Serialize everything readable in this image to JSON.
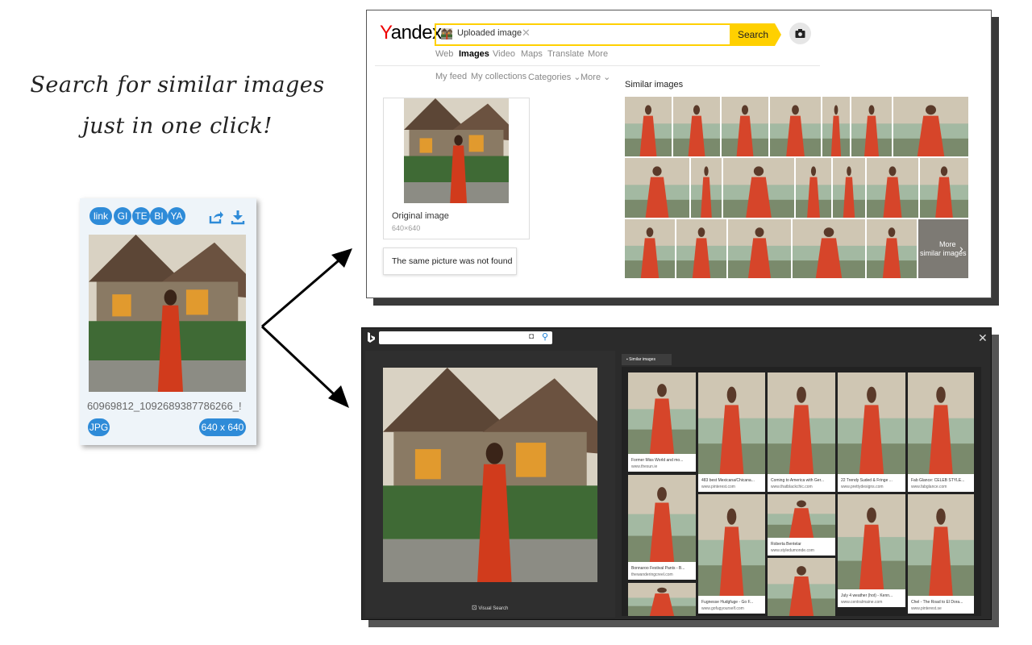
{
  "headline": {
    "line1": "Search for similar images",
    "line2": "just in one click!"
  },
  "extension": {
    "buttons": [
      "link",
      "GI",
      "TE",
      "BI",
      "YA"
    ],
    "filename": "60969812_1092689387786266_!",
    "format": "JPG",
    "dimensions": "640 x 640"
  },
  "yandex": {
    "logo_first": "Y",
    "logo_rest": "andex",
    "search_chip": "Uploaded image",
    "search_button": "Search",
    "nav": [
      "Web",
      "Images",
      "Video",
      "Maps",
      "Translate",
      "More"
    ],
    "subnav": [
      "My feed",
      "My collections",
      "Categories",
      "More"
    ],
    "similar_title": "Similar images",
    "original_label": "Original image",
    "original_size": "640×640",
    "not_found": "The same picture was not found",
    "more_similar_line1": "More",
    "more_similar_line2": "similar images"
  },
  "bing": {
    "tab_label": "Similar images",
    "visual_search": "Visual Search",
    "cards": [
      {
        "caption": "Former Miss World and mo...",
        "url": "www.thesun.ie"
      },
      {
        "caption": "483 best Mexicana/Chicana...",
        "url": "www.pinterest.com"
      },
      {
        "caption": "Coming to America with Ger...",
        "url": "www.thatblackchic.com"
      },
      {
        "caption": "22 Trendy Suded & Fringe ...",
        "url": "www.prettydesigns.com"
      },
      {
        "caption": "Fab Glance: CELEB STYLE...",
        "url": "www.fabglance.com"
      },
      {
        "caption": "Bonnaroo Festival Pants - B...",
        "url": "thewanderingcreel.com"
      },
      {
        "caption": "Roberta Bentelar",
        "url": "www.styledumonde.com"
      },
      {
        "caption": "Fugnesse Hudgfuge - Go F...",
        "url": "www.gofugyourself.com"
      },
      {
        "caption": "July 4 weather (hot) - Kenn...",
        "url": "www.centralmaine.com"
      },
      {
        "caption": "Chel - The Road to El Dora...",
        "url": "www.pinterest.se"
      }
    ]
  }
}
